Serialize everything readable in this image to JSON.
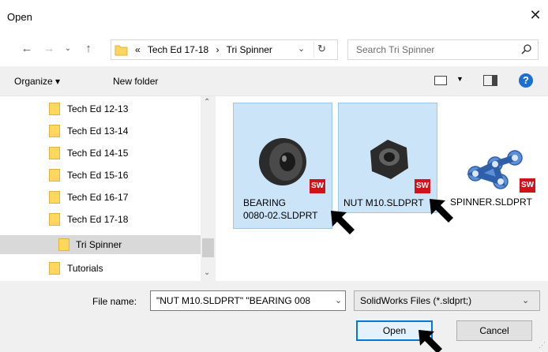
{
  "window": {
    "title": "Open"
  },
  "nav": {
    "breadcrumb_overflow": "«",
    "breadcrumb": [
      "Tech Ed 17-18",
      "›",
      "Tri Spinner"
    ],
    "search_placeholder": "Search Tri Spinner"
  },
  "toolbar": {
    "organize_label": "Organize ▾",
    "newfolder_label": "New folder",
    "help": "?"
  },
  "tree": {
    "items": [
      {
        "label": "Tech Ed 12-13",
        "indent": 1,
        "selected": false
      },
      {
        "label": "Tech Ed 13-14",
        "indent": 1,
        "selected": false
      },
      {
        "label": "Tech Ed 14-15",
        "indent": 1,
        "selected": false
      },
      {
        "label": "Tech Ed 15-16",
        "indent": 1,
        "selected": false
      },
      {
        "label": "Tech Ed 16-17",
        "indent": 1,
        "selected": false
      },
      {
        "label": "Tech Ed 17-18",
        "indent": 1,
        "selected": false
      },
      {
        "label": "Tri Spinner",
        "indent": 2,
        "selected": true
      },
      {
        "label": "Tutorials",
        "indent": 1,
        "selected": false
      }
    ]
  },
  "files": [
    {
      "name_line1": "BEARING",
      "name_line2": "0080-02.SLDPRT",
      "selected": true,
      "badge": "SW"
    },
    {
      "name_line1": "NUT M10.SLDPRT",
      "name_line2": "",
      "selected": true,
      "badge": "SW"
    },
    {
      "name_line1": "SPINNER.SLDPRT",
      "name_line2": "",
      "selected": false,
      "badge": "SW"
    }
  ],
  "bottom": {
    "filename_label": "File name:",
    "filename_value": "\"NUT M10.SLDPRT\" \"BEARING 008",
    "filter_value": "SolidWorks Files (*.sldprt;)",
    "open_label": "Open",
    "cancel_label": "Cancel"
  },
  "colors": {
    "selection_bg": "#cce4f7",
    "accent": "#0078d7",
    "sw_red": "#d0121b",
    "folder": "#ffd75e"
  }
}
